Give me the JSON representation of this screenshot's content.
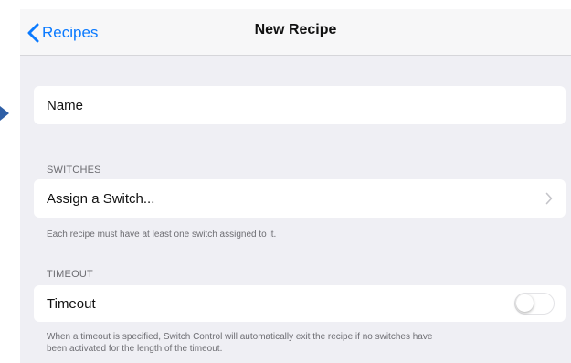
{
  "colors": {
    "accent": "#0a7aff",
    "background": "#efeff4",
    "cell": "#ffffff",
    "secondary_text": "#6d6d72"
  },
  "navbar": {
    "back_label": "Recipes",
    "title": "New Recipe"
  },
  "name_field": {
    "placeholder": "Name"
  },
  "switches_section": {
    "header": "SWITCHES",
    "cell_label": "Assign a Switch...",
    "footer": "Each recipe must have at least one switch assigned to it."
  },
  "timeout_section": {
    "header": "TIMEOUT",
    "cell_label": "Timeout",
    "toggle_on": false,
    "footer_line1": "When a timeout is specified, Switch Control will automatically exit the recipe if no switches have",
    "footer_line2": "been activated for the length of the timeout."
  },
  "icons": {
    "back": "chevron-left-icon",
    "disclosure": "chevron-right-icon",
    "pointer": "pointer-arrow-icon"
  }
}
